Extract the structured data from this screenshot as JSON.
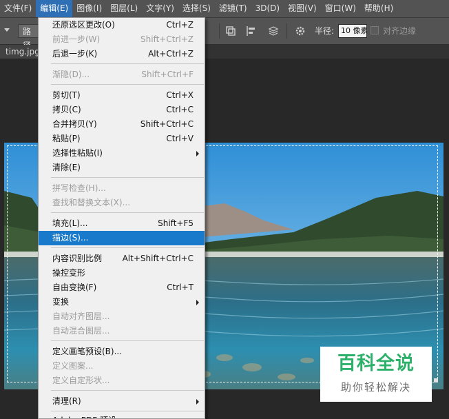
{
  "menubar": {
    "items": [
      {
        "label": "文件(F)"
      },
      {
        "label": "编辑(E)"
      },
      {
        "label": "图像(I)"
      },
      {
        "label": "图层(L)"
      },
      {
        "label": "文字(Y)"
      },
      {
        "label": "选择(S)"
      },
      {
        "label": "滤镜(T)"
      },
      {
        "label": "3D(D)"
      },
      {
        "label": "视图(V)"
      },
      {
        "label": "窗口(W)"
      },
      {
        "label": "帮助(H)"
      }
    ]
  },
  "options_bar": {
    "path_select_value": "路径",
    "radius_label": "半径:",
    "radius_value": "10 像素",
    "align_edges_label": "对齐边缘"
  },
  "document": {
    "tab_name": "timg.jpg"
  },
  "watermark": {
    "title": "百科全说",
    "subtitle": "助你轻松解决"
  },
  "edit_menu": {
    "items": [
      {
        "label": "还原选区更改(O)",
        "shortcut": "Ctrl+Z"
      },
      {
        "label": "前进一步(W)",
        "shortcut": "Shift+Ctrl+Z"
      },
      {
        "label": "后退一步(K)",
        "shortcut": "Alt+Ctrl+Z"
      },
      {
        "label": "渐隐(D)...",
        "shortcut": "Shift+Ctrl+F"
      },
      {
        "label": "剪切(T)",
        "shortcut": "Ctrl+X"
      },
      {
        "label": "拷贝(C)",
        "shortcut": "Ctrl+C"
      },
      {
        "label": "合并拷贝(Y)",
        "shortcut": "Shift+Ctrl+C"
      },
      {
        "label": "粘贴(P)",
        "shortcut": "Ctrl+V"
      },
      {
        "label": "选择性粘贴(I)",
        "shortcut": ""
      },
      {
        "label": "清除(E)",
        "shortcut": ""
      },
      {
        "label": "拼写检查(H)...",
        "shortcut": ""
      },
      {
        "label": "查找和替换文本(X)...",
        "shortcut": ""
      },
      {
        "label": "填充(L)...",
        "shortcut": "Shift+F5"
      },
      {
        "label": "描边(S)...",
        "shortcut": ""
      },
      {
        "label": "内容识别比例",
        "shortcut": "Alt+Shift+Ctrl+C"
      },
      {
        "label": "操控变形",
        "shortcut": ""
      },
      {
        "label": "自由变换(F)",
        "shortcut": "Ctrl+T"
      },
      {
        "label": "变换",
        "shortcut": ""
      },
      {
        "label": "自动对齐图层...",
        "shortcut": ""
      },
      {
        "label": "自动混合图层...",
        "shortcut": ""
      },
      {
        "label": "定义画笔预设(B)...",
        "shortcut": ""
      },
      {
        "label": "定义图案...",
        "shortcut": ""
      },
      {
        "label": "定义自定形状...",
        "shortcut": ""
      },
      {
        "label": "清理(R)",
        "shortcut": ""
      },
      {
        "label": "Adobe PDF 预设...",
        "shortcut": ""
      }
    ]
  }
}
